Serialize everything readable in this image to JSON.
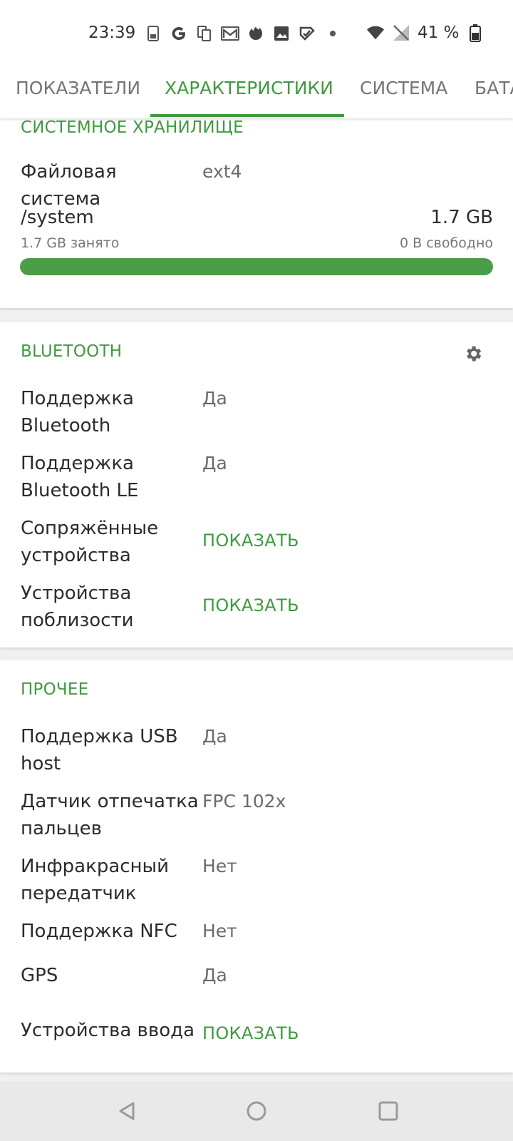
{
  "status_bar": {
    "time": "23:39",
    "battery_percent": "41 %",
    "notification_icons": [
      "sim-icon",
      "google-icon",
      "copy-icon",
      "mail-icon",
      "firefox-icon",
      "image-icon",
      "task-icon",
      "dot-icon"
    ],
    "right_icons": [
      "wifi-icon",
      "no-signal-icon",
      "battery-icon"
    ]
  },
  "tabs": [
    {
      "label": "ПОКАЗАТЕЛИ",
      "active": false
    },
    {
      "label": "ХАРАКТЕРИСТИКИ",
      "active": true
    },
    {
      "label": "СИСТЕМА",
      "active": false
    },
    {
      "label": "БАТА",
      "active": false
    }
  ],
  "storage": {
    "title": "СИСТЕМНОЕ ХРАНИЛИЩЕ",
    "fs_label": "Файловая система",
    "fs_value": "ext4",
    "name": "/system",
    "total": "1.7 GB",
    "used": "1.7 GB занято",
    "free": "0 B свободно",
    "used_fraction": 1.0
  },
  "bluetooth": {
    "title": "BLUETOOTH",
    "settings_icon": "gear-icon",
    "rows": [
      {
        "label": "Поддержка Bluetooth",
        "value": "Да"
      },
      {
        "label": "Поддержка Bluetooth LE",
        "value": "Да"
      },
      {
        "label": "Сопряжённые устройства",
        "link": "ПОКАЗАТЬ"
      },
      {
        "label": "Устройства поблизости",
        "link": "ПОКАЗАТЬ"
      }
    ]
  },
  "other": {
    "title": "ПРОЧЕЕ",
    "rows": [
      {
        "label": "Поддержка USB host",
        "value": "Да"
      },
      {
        "label": "Датчик отпечатка пальцев",
        "value": "FPC 102x"
      },
      {
        "label": "Инфракрасный передатчик",
        "value": "Нет"
      },
      {
        "label": "Поддержка NFC",
        "value": "Нет"
      },
      {
        "label": "GPS",
        "value": "Да"
      },
      {
        "label": "Устройства ввода",
        "link": "ПОКАЗАТЬ"
      }
    ]
  },
  "colors": {
    "accent": "#3f9a3f",
    "progress": "#4a9e48"
  }
}
